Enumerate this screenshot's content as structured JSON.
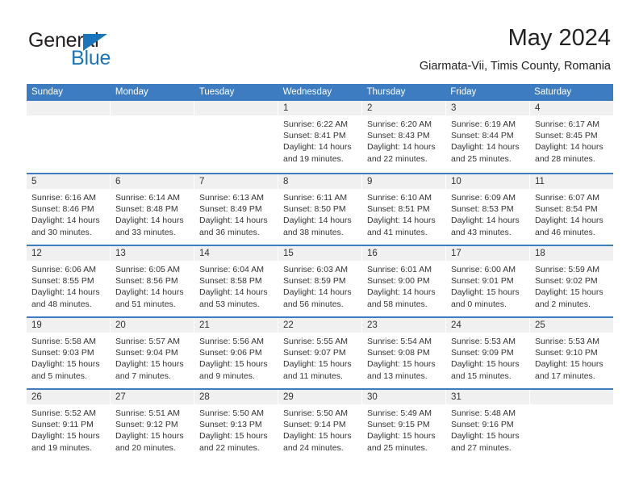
{
  "brand": {
    "name_part1": "General",
    "name_part2": "Blue",
    "logo_icon": "triangle-flag-icon",
    "accent_color": "#1b75bb"
  },
  "header": {
    "title": "May 2024",
    "subtitle": "Giarmata-Vii, Timis County, Romania"
  },
  "theme": {
    "header_blue": "#3d7cc0",
    "day_band_gray": "#f0f0f0",
    "text_color": "#333333"
  },
  "calendar": {
    "weekdays": [
      "Sunday",
      "Monday",
      "Tuesday",
      "Wednesday",
      "Thursday",
      "Friday",
      "Saturday"
    ],
    "weeks": [
      [
        {
          "day": "",
          "empty": true,
          "sunrise": "",
          "sunset": "",
          "daylight_line1": "",
          "daylight_line2": ""
        },
        {
          "day": "",
          "empty": true,
          "sunrise": "",
          "sunset": "",
          "daylight_line1": "",
          "daylight_line2": ""
        },
        {
          "day": "",
          "empty": true,
          "sunrise": "",
          "sunset": "",
          "daylight_line1": "",
          "daylight_line2": ""
        },
        {
          "day": "1",
          "empty": false,
          "sunrise": "Sunrise: 6:22 AM",
          "sunset": "Sunset: 8:41 PM",
          "daylight_line1": "Daylight: 14 hours",
          "daylight_line2": "and 19 minutes."
        },
        {
          "day": "2",
          "empty": false,
          "sunrise": "Sunrise: 6:20 AM",
          "sunset": "Sunset: 8:43 PM",
          "daylight_line1": "Daylight: 14 hours",
          "daylight_line2": "and 22 minutes."
        },
        {
          "day": "3",
          "empty": false,
          "sunrise": "Sunrise: 6:19 AM",
          "sunset": "Sunset: 8:44 PM",
          "daylight_line1": "Daylight: 14 hours",
          "daylight_line2": "and 25 minutes."
        },
        {
          "day": "4",
          "empty": false,
          "sunrise": "Sunrise: 6:17 AM",
          "sunset": "Sunset: 8:45 PM",
          "daylight_line1": "Daylight: 14 hours",
          "daylight_line2": "and 28 minutes."
        }
      ],
      [
        {
          "day": "5",
          "empty": false,
          "sunrise": "Sunrise: 6:16 AM",
          "sunset": "Sunset: 8:46 PM",
          "daylight_line1": "Daylight: 14 hours",
          "daylight_line2": "and 30 minutes."
        },
        {
          "day": "6",
          "empty": false,
          "sunrise": "Sunrise: 6:14 AM",
          "sunset": "Sunset: 8:48 PM",
          "daylight_line1": "Daylight: 14 hours",
          "daylight_line2": "and 33 minutes."
        },
        {
          "day": "7",
          "empty": false,
          "sunrise": "Sunrise: 6:13 AM",
          "sunset": "Sunset: 8:49 PM",
          "daylight_line1": "Daylight: 14 hours",
          "daylight_line2": "and 36 minutes."
        },
        {
          "day": "8",
          "empty": false,
          "sunrise": "Sunrise: 6:11 AM",
          "sunset": "Sunset: 8:50 PM",
          "daylight_line1": "Daylight: 14 hours",
          "daylight_line2": "and 38 minutes."
        },
        {
          "day": "9",
          "empty": false,
          "sunrise": "Sunrise: 6:10 AM",
          "sunset": "Sunset: 8:51 PM",
          "daylight_line1": "Daylight: 14 hours",
          "daylight_line2": "and 41 minutes."
        },
        {
          "day": "10",
          "empty": false,
          "sunrise": "Sunrise: 6:09 AM",
          "sunset": "Sunset: 8:53 PM",
          "daylight_line1": "Daylight: 14 hours",
          "daylight_line2": "and 43 minutes."
        },
        {
          "day": "11",
          "empty": false,
          "sunrise": "Sunrise: 6:07 AM",
          "sunset": "Sunset: 8:54 PM",
          "daylight_line1": "Daylight: 14 hours",
          "daylight_line2": "and 46 minutes."
        }
      ],
      [
        {
          "day": "12",
          "empty": false,
          "sunrise": "Sunrise: 6:06 AM",
          "sunset": "Sunset: 8:55 PM",
          "daylight_line1": "Daylight: 14 hours",
          "daylight_line2": "and 48 minutes."
        },
        {
          "day": "13",
          "empty": false,
          "sunrise": "Sunrise: 6:05 AM",
          "sunset": "Sunset: 8:56 PM",
          "daylight_line1": "Daylight: 14 hours",
          "daylight_line2": "and 51 minutes."
        },
        {
          "day": "14",
          "empty": false,
          "sunrise": "Sunrise: 6:04 AM",
          "sunset": "Sunset: 8:58 PM",
          "daylight_line1": "Daylight: 14 hours",
          "daylight_line2": "and 53 minutes."
        },
        {
          "day": "15",
          "empty": false,
          "sunrise": "Sunrise: 6:03 AM",
          "sunset": "Sunset: 8:59 PM",
          "daylight_line1": "Daylight: 14 hours",
          "daylight_line2": "and 56 minutes."
        },
        {
          "day": "16",
          "empty": false,
          "sunrise": "Sunrise: 6:01 AM",
          "sunset": "Sunset: 9:00 PM",
          "daylight_line1": "Daylight: 14 hours",
          "daylight_line2": "and 58 minutes."
        },
        {
          "day": "17",
          "empty": false,
          "sunrise": "Sunrise: 6:00 AM",
          "sunset": "Sunset: 9:01 PM",
          "daylight_line1": "Daylight: 15 hours",
          "daylight_line2": "and 0 minutes."
        },
        {
          "day": "18",
          "empty": false,
          "sunrise": "Sunrise: 5:59 AM",
          "sunset": "Sunset: 9:02 PM",
          "daylight_line1": "Daylight: 15 hours",
          "daylight_line2": "and 2 minutes."
        }
      ],
      [
        {
          "day": "19",
          "empty": false,
          "sunrise": "Sunrise: 5:58 AM",
          "sunset": "Sunset: 9:03 PM",
          "daylight_line1": "Daylight: 15 hours",
          "daylight_line2": "and 5 minutes."
        },
        {
          "day": "20",
          "empty": false,
          "sunrise": "Sunrise: 5:57 AM",
          "sunset": "Sunset: 9:04 PM",
          "daylight_line1": "Daylight: 15 hours",
          "daylight_line2": "and 7 minutes."
        },
        {
          "day": "21",
          "empty": false,
          "sunrise": "Sunrise: 5:56 AM",
          "sunset": "Sunset: 9:06 PM",
          "daylight_line1": "Daylight: 15 hours",
          "daylight_line2": "and 9 minutes."
        },
        {
          "day": "22",
          "empty": false,
          "sunrise": "Sunrise: 5:55 AM",
          "sunset": "Sunset: 9:07 PM",
          "daylight_line1": "Daylight: 15 hours",
          "daylight_line2": "and 11 minutes."
        },
        {
          "day": "23",
          "empty": false,
          "sunrise": "Sunrise: 5:54 AM",
          "sunset": "Sunset: 9:08 PM",
          "daylight_line1": "Daylight: 15 hours",
          "daylight_line2": "and 13 minutes."
        },
        {
          "day": "24",
          "empty": false,
          "sunrise": "Sunrise: 5:53 AM",
          "sunset": "Sunset: 9:09 PM",
          "daylight_line1": "Daylight: 15 hours",
          "daylight_line2": "and 15 minutes."
        },
        {
          "day": "25",
          "empty": false,
          "sunrise": "Sunrise: 5:53 AM",
          "sunset": "Sunset: 9:10 PM",
          "daylight_line1": "Daylight: 15 hours",
          "daylight_line2": "and 17 minutes."
        }
      ],
      [
        {
          "day": "26",
          "empty": false,
          "sunrise": "Sunrise: 5:52 AM",
          "sunset": "Sunset: 9:11 PM",
          "daylight_line1": "Daylight: 15 hours",
          "daylight_line2": "and 19 minutes."
        },
        {
          "day": "27",
          "empty": false,
          "sunrise": "Sunrise: 5:51 AM",
          "sunset": "Sunset: 9:12 PM",
          "daylight_line1": "Daylight: 15 hours",
          "daylight_line2": "and 20 minutes."
        },
        {
          "day": "28",
          "empty": false,
          "sunrise": "Sunrise: 5:50 AM",
          "sunset": "Sunset: 9:13 PM",
          "daylight_line1": "Daylight: 15 hours",
          "daylight_line2": "and 22 minutes."
        },
        {
          "day": "29",
          "empty": false,
          "sunrise": "Sunrise: 5:50 AM",
          "sunset": "Sunset: 9:14 PM",
          "daylight_line1": "Daylight: 15 hours",
          "daylight_line2": "and 24 minutes."
        },
        {
          "day": "30",
          "empty": false,
          "sunrise": "Sunrise: 5:49 AM",
          "sunset": "Sunset: 9:15 PM",
          "daylight_line1": "Daylight: 15 hours",
          "daylight_line2": "and 25 minutes."
        },
        {
          "day": "31",
          "empty": false,
          "sunrise": "Sunrise: 5:48 AM",
          "sunset": "Sunset: 9:16 PM",
          "daylight_line1": "Daylight: 15 hours",
          "daylight_line2": "and 27 minutes."
        },
        {
          "day": "",
          "empty": true,
          "sunrise": "",
          "sunset": "",
          "daylight_line1": "",
          "daylight_line2": ""
        }
      ]
    ]
  }
}
